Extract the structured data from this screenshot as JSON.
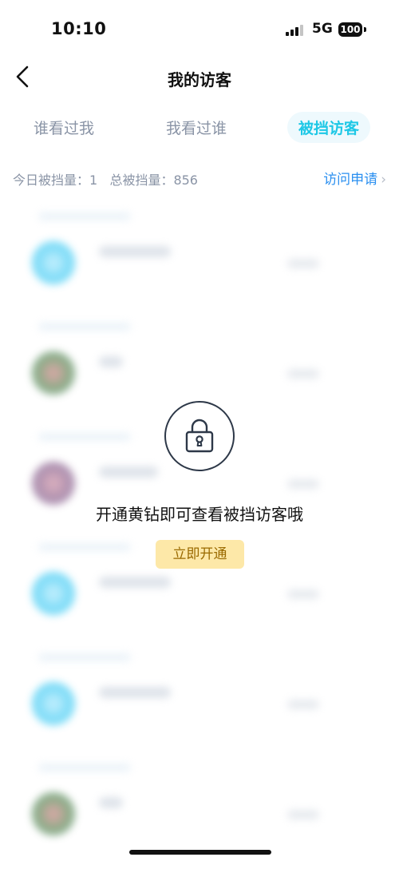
{
  "status_bar": {
    "time": "10:10",
    "network": "5G",
    "battery": "100"
  },
  "nav": {
    "title": "我的访客",
    "back_icon": "chevron-left-icon"
  },
  "tabs": [
    {
      "label": "谁看过我"
    },
    {
      "label": "我看过谁"
    },
    {
      "label": "被挡访客",
      "active": true
    }
  ],
  "stats": {
    "summary": "今日被挡量：1   总被挡量：856",
    "link_label": "访问申请",
    "link_icon": "chevron-right-icon"
  },
  "overlay": {
    "icon": "lock-icon",
    "message": "开通黄钻即可查看被挡访客哦",
    "button_label": "立即开通"
  },
  "colors": {
    "accent": "#1ec8e6",
    "link": "#2a8ff0",
    "muted": "#8a94a6",
    "button_bg": "#fde8a8",
    "button_text": "#9a6a00"
  }
}
